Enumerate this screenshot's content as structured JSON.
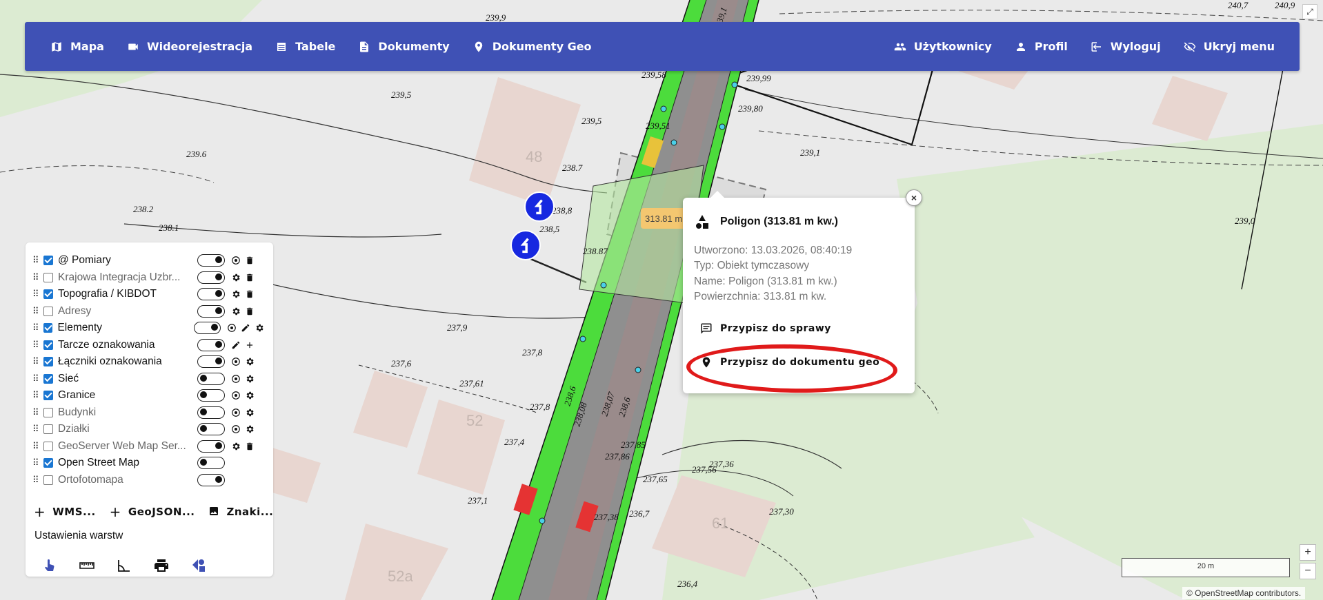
{
  "nav": {
    "left": [
      {
        "label": "Mapa",
        "icon": "map-icon"
      },
      {
        "label": "Wideorejestracja",
        "icon": "video-icon"
      },
      {
        "label": "Tabele",
        "icon": "table-icon"
      },
      {
        "label": "Dokumenty",
        "icon": "document-icon"
      },
      {
        "label": "Dokumenty Geo",
        "icon": "location-pin-icon"
      }
    ],
    "right": [
      {
        "label": "Użytkownicy",
        "icon": "users-icon"
      },
      {
        "label": "Profil",
        "icon": "person-icon"
      },
      {
        "label": "Wyloguj",
        "icon": "logout-icon"
      },
      {
        "label": "Ukryj menu",
        "icon": "eye-off-icon"
      }
    ]
  },
  "layers": [
    {
      "name": "@ Pomiary",
      "checked": true
    },
    {
      "name": "Krajowa Integracja Uzbr...",
      "checked": false
    },
    {
      "name": "Topografia / KIBDOT",
      "checked": true
    },
    {
      "name": "Adresy",
      "checked": false
    },
    {
      "name": "Elementy",
      "checked": true
    },
    {
      "name": "Tarcze oznakowania",
      "checked": true
    },
    {
      "name": "Łączniki oznakowania",
      "checked": true
    },
    {
      "name": "Sieć",
      "checked": true
    },
    {
      "name": "Granice",
      "checked": true
    },
    {
      "name": "Budynki",
      "checked": false
    },
    {
      "name": "Działki",
      "checked": false
    },
    {
      "name": "GeoServer Web Map Ser...",
      "checked": false
    },
    {
      "name": "Open Street Map",
      "checked": true
    },
    {
      "name": "Ortofotomapa",
      "checked": false
    }
  ],
  "layer_actions": {
    "wms": "WMS...",
    "geojson": "GeoJSON...",
    "znaki": "Znaki..."
  },
  "layer_settings_label": "Ustawienia warstw",
  "tools": [
    "hand-pointer-icon",
    "ruler-icon",
    "angle-icon",
    "print-icon",
    "shapes-icon"
  ],
  "popup": {
    "title": "Poligon (313.81 m kw.)",
    "created": "Utworzono: 13.03.2026, 08:40:19",
    "type": "Typ: Obiekt tymczasowy",
    "name": "Name: Poligon (313.81 m kw.)",
    "area": "Powierzchnia: 313.81 m kw.",
    "action_case": "Przypisz do sprawy",
    "action_geo_doc": "Przypisz do dokumentu geo",
    "close": "×"
  },
  "area_label": "313.81 m",
  "map": {
    "building_numbers": [
      "48",
      "52",
      "61",
      "52a"
    ],
    "elevations": [
      "239,9",
      "239,5",
      "239,5",
      "239.6",
      "238.2",
      "238.1",
      "238.7",
      "238,8",
      "238,5",
      "238.87",
      "237,9",
      "237,8",
      "237,6",
      "237,61",
      "237,8",
      "237,4",
      "237,1",
      "237,38",
      "236,7",
      "236,4",
      "237,85",
      "237,86",
      "237,65",
      "237,56",
      "237,36",
      "237,30",
      "239,80",
      "239,99",
      "239,1",
      "239,0",
      "240,7",
      "240,9",
      "239,58",
      "239,51",
      "238,6",
      "238,08",
      "238,07",
      "238,6",
      "239,1"
    ],
    "scale_label": "20 m",
    "attribution": "© OpenStreetMap contributors.",
    "zoom_in": "+",
    "zoom_out": "−",
    "colors": {
      "road_green": "#4cdc3c",
      "road_gray": "#8a8a8a",
      "land_green": "#dcebd2",
      "building": "#e8d6d0",
      "nav": "#3f51b5",
      "highlight": "#e01a1a",
      "marker": "#1728e0"
    }
  }
}
